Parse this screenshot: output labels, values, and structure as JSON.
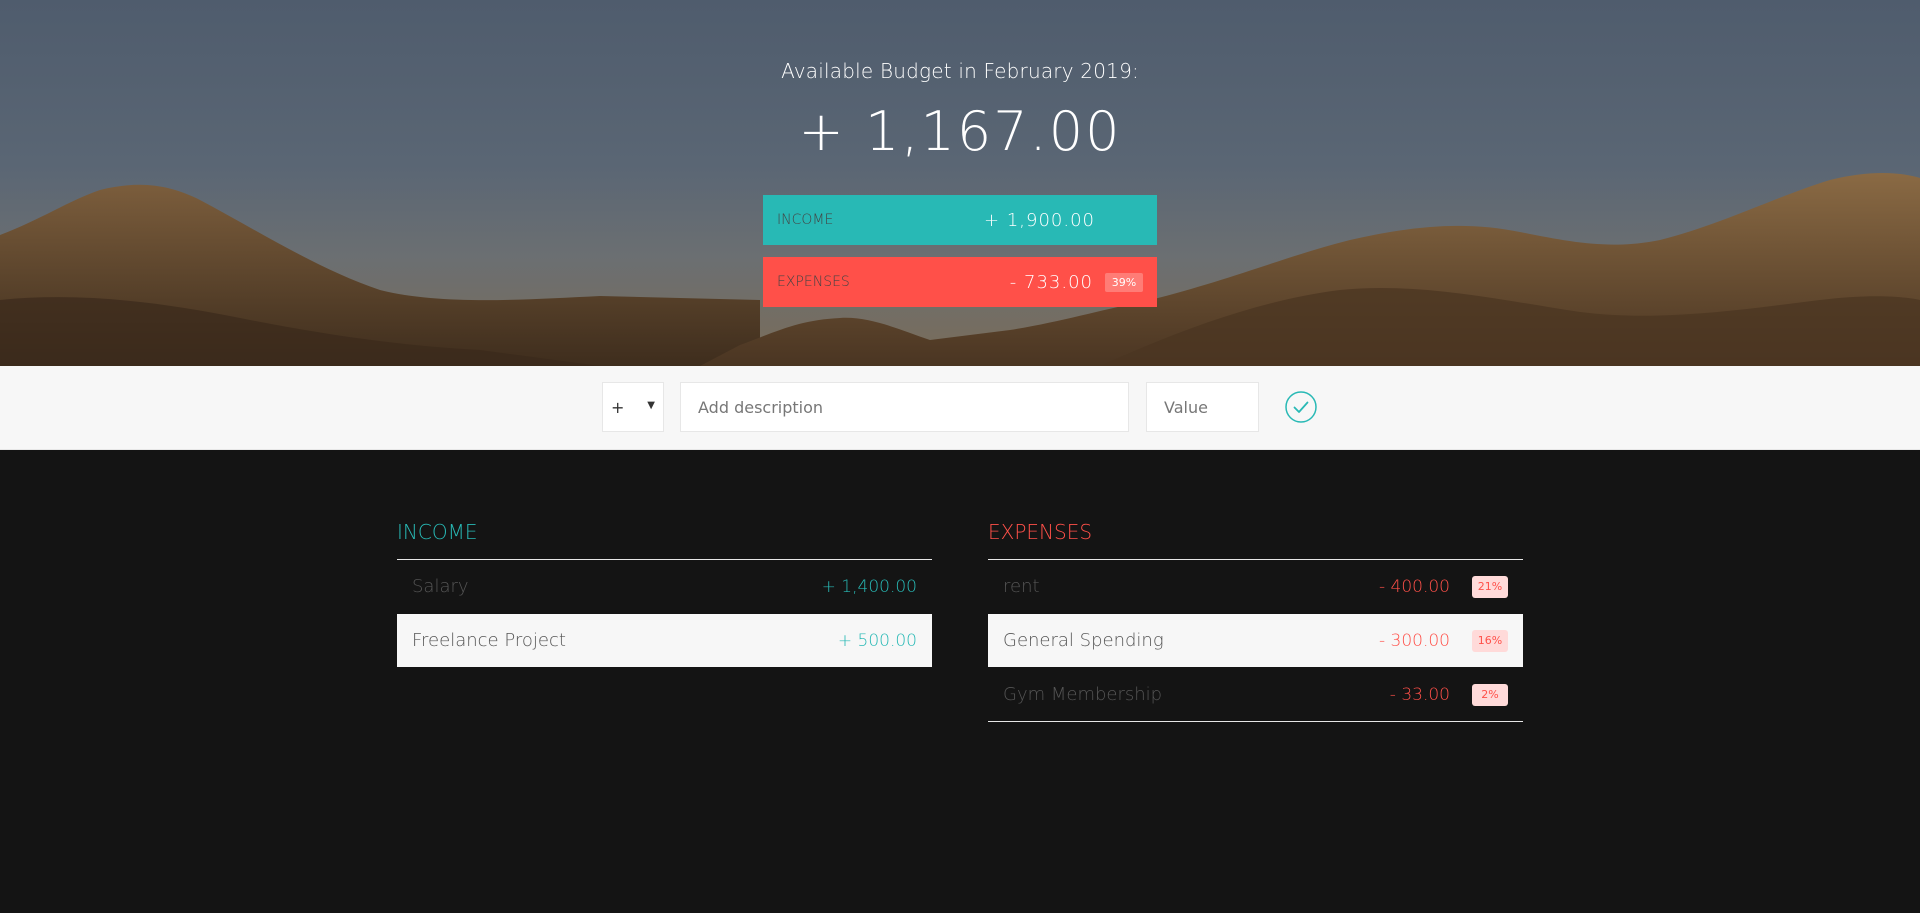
{
  "header": {
    "title": "Available Budget in February 2019:",
    "budget": "+ 1,167.00",
    "income_label": "Income",
    "income_value": "+ 1,900.00",
    "expenses_label": "Expenses",
    "expenses_value": "- 733.00",
    "expenses_percentage": "39%"
  },
  "add_form": {
    "type_value": "+",
    "description_placeholder": "Add description",
    "value_placeholder": "Value",
    "submit_icon": "checkmark-circle-icon"
  },
  "income": {
    "title": "Income",
    "items": [
      {
        "description": "Salary",
        "value": "+ 1,400.00"
      },
      {
        "description": "Freelance Project",
        "value": "+ 500.00"
      }
    ]
  },
  "expenses": {
    "title": "Expenses",
    "items": [
      {
        "description": "rent",
        "value": "- 400.00",
        "percentage": "21%"
      },
      {
        "description": "General Spending",
        "value": "- 300.00",
        "percentage": "16%"
      },
      {
        "description": "Gym Membership",
        "value": "- 33.00",
        "percentage": "2%"
      }
    ]
  },
  "colors": {
    "income_accent": "#28b9b5",
    "expense_accent": "#ff5049",
    "background": "#141414"
  }
}
